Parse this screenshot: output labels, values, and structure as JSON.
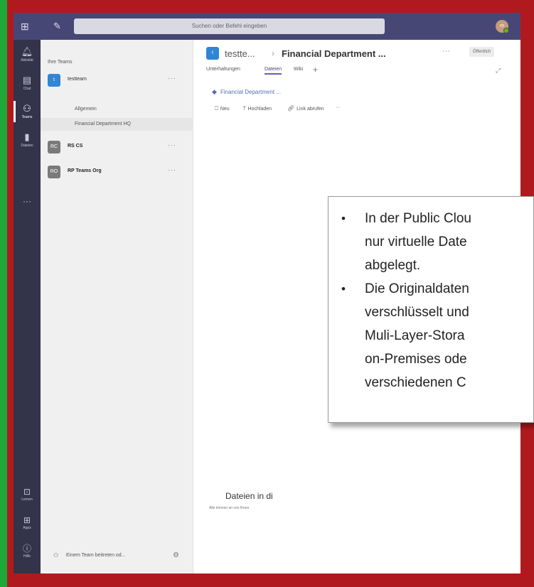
{
  "colors": {
    "frame": "#b01a1e",
    "left_bar": "#1fa83a",
    "titlebar": "#464775",
    "rail": "#33344a",
    "accent": "#6264a7"
  },
  "titlebar": {
    "search_placeholder": "Suchen oder Befehl eingeben",
    "avatar_initials": "m"
  },
  "rail": {
    "items": [
      {
        "label": "Aktivität",
        "icon": "bell-icon"
      },
      {
        "label": "Chat",
        "icon": "chat-icon"
      },
      {
        "label": "Teams",
        "icon": "teams-icon"
      },
      {
        "label": "Dateien",
        "icon": "file-icon"
      }
    ],
    "more": "···",
    "bottom": [
      {
        "label": "Lernen",
        "icon": "app-icon"
      },
      {
        "label": "Apps",
        "icon": "apps-icon"
      },
      {
        "label": "Hilfe",
        "icon": "help-icon"
      }
    ]
  },
  "teams_pane": {
    "header": "Ihre Teams",
    "teams": [
      {
        "name": "testteam",
        "initials": "t",
        "color": "#2f86d6",
        "more": "···",
        "channels": [
          "Allgemein",
          "Financial Department HQ"
        ]
      },
      {
        "name": "RS CS",
        "initials": "RC",
        "color": "#7a7a7a",
        "more": "···"
      },
      {
        "name": "RP Teams Org",
        "initials": "RO",
        "color": "#7a7a7a",
        "more": "···"
      }
    ],
    "footer": {
      "text": "Einem Team beitreten od...",
      "icon": "join-team-icon",
      "gear": "gear-icon"
    }
  },
  "main": {
    "header": {
      "avatar": "t",
      "crumb": "testte...",
      "separator": "›",
      "title": "Financial Department ...",
      "more": "···",
      "badge": "Öffentlich"
    },
    "tabs": [
      "Unterhaltungen",
      "Dateien",
      "Wiki"
    ],
    "active_tab": "Dateien",
    "tab_add": "+",
    "sharepoint_title": "Financial Department ...",
    "commands": [
      {
        "label": "Neu",
        "icon": "new-icon"
      },
      {
        "label": "Hochladen",
        "icon": "upload-icon"
      },
      {
        "label": "Link abrufen",
        "icon": "link-icon"
      },
      {
        "label": "···",
        "icon": "more-icon"
      }
    ],
    "empty_title": "Dateien in di",
    "empty_subtitle": "Alle können an von Ihnen"
  },
  "overlay": {
    "bullets": [
      [
        "In der Public Clou",
        "nur virtuelle Date",
        "abgelegt."
      ],
      [
        "Die Originaldaten",
        "verschlüsselt und",
        "Muli-Layer-Stora",
        "on-Premises ode",
        "verschiedenen C"
      ]
    ]
  }
}
